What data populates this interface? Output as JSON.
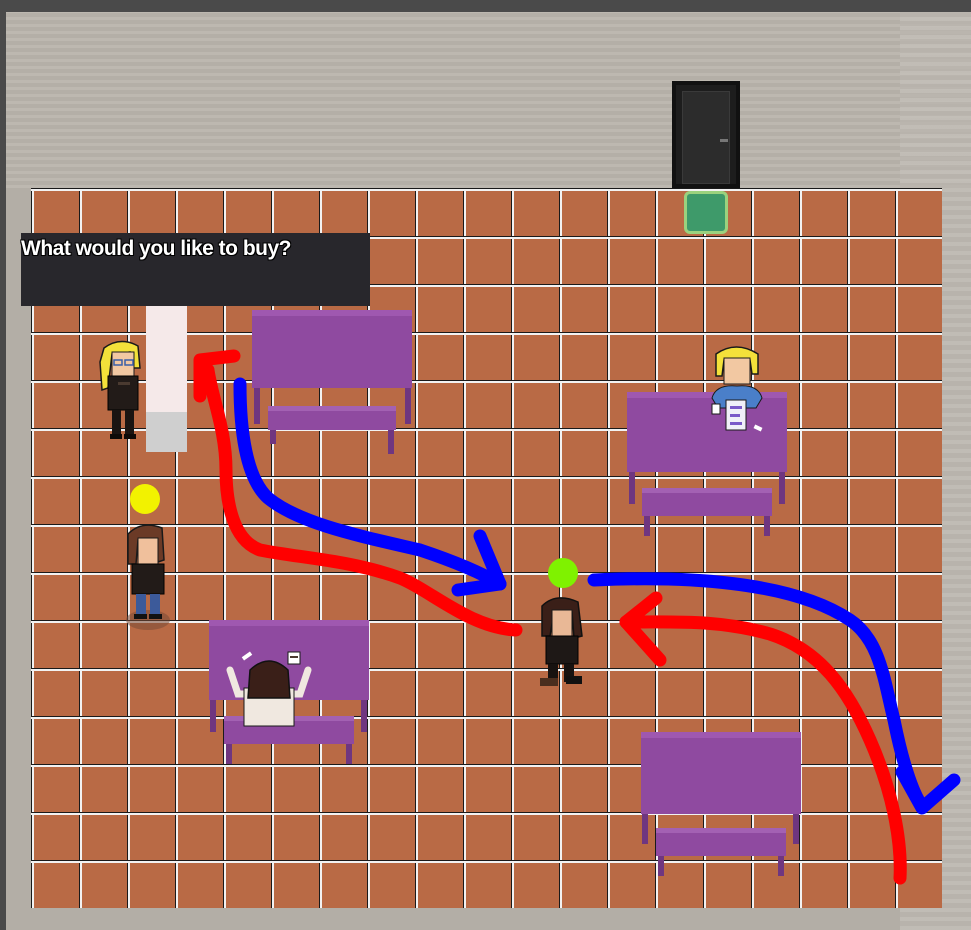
{
  "dialog": {
    "text": "What would you like to buy?"
  },
  "colors": {
    "floor_brick": "#b96a45",
    "grout": "#f2f2f2",
    "wall": "#b7b2aa",
    "table_purple": "#8f4aa0",
    "dialog_bg": "#28272c",
    "door_mat": "#3e9a6a",
    "marker_yellow": "#f2f200",
    "marker_green": "#7ff200",
    "path_red": "#ff0000",
    "path_blue": "#0000ff"
  },
  "markers": [
    {
      "name": "waiting-customer-marker",
      "color": "yellow"
    },
    {
      "name": "player-marker",
      "color": "green"
    }
  ],
  "characters": [
    {
      "name": "shopkeeper",
      "hair": "blonde"
    },
    {
      "name": "customer-in-line",
      "hair": "brown"
    },
    {
      "name": "player",
      "hair": "dark"
    },
    {
      "name": "seated-customer-top-right",
      "hair": "blonde"
    },
    {
      "name": "seated-customer-bottom-left",
      "hair": "dark"
    }
  ]
}
